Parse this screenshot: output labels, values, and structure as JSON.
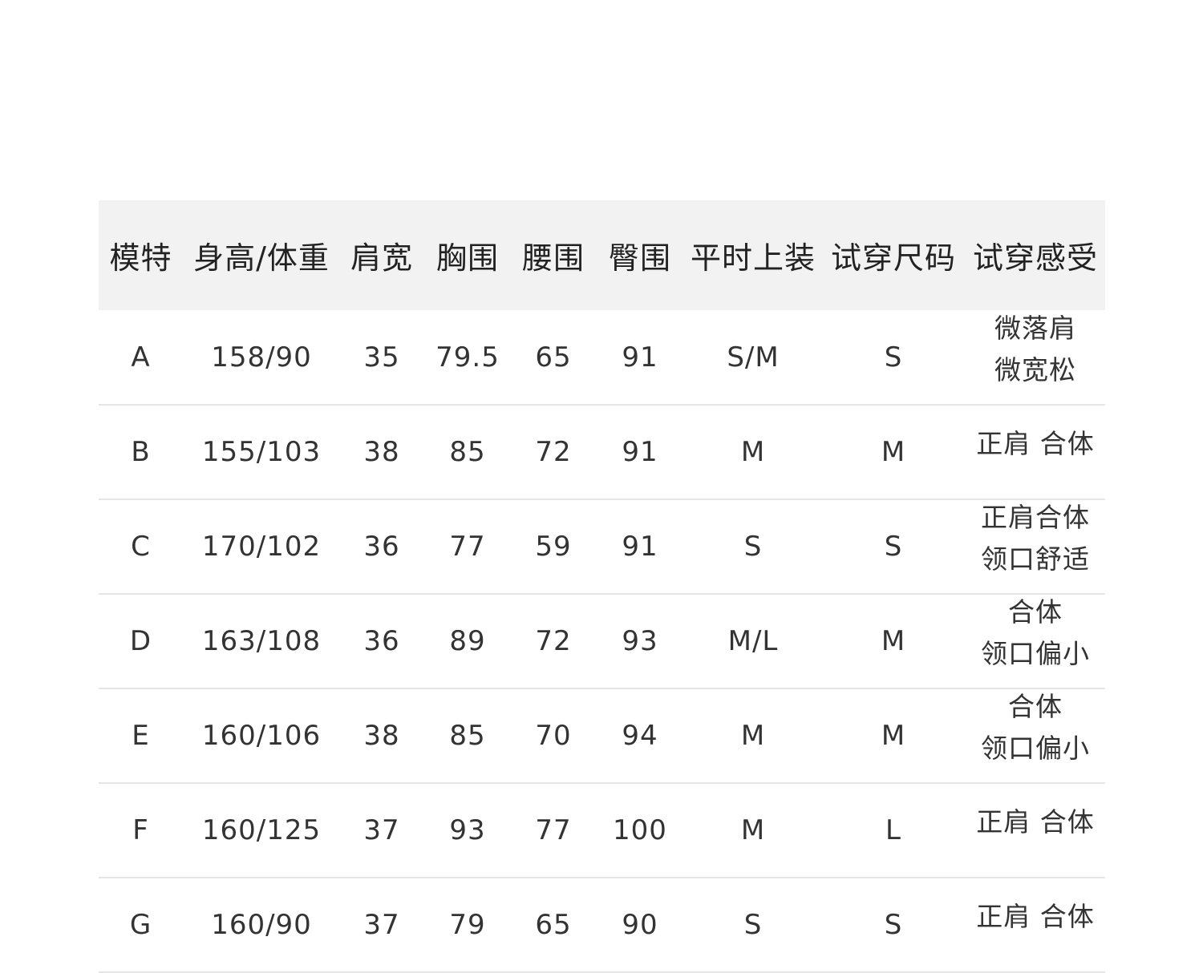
{
  "table": {
    "headers": [
      "模特",
      "身高/体重",
      "肩宽",
      "胸围",
      "腰围",
      "臀围",
      "平时上装",
      "试穿尺码",
      "试穿感受"
    ],
    "rows": [
      [
        "A",
        "158/90",
        "35",
        "79.5",
        "65",
        "91",
        "S/M",
        "S",
        "微落肩\n微宽松"
      ],
      [
        "B",
        "155/103",
        "38",
        "85",
        "72",
        "91",
        "M",
        "M",
        "正肩 合体"
      ],
      [
        "C",
        "170/102",
        "36",
        "77",
        "59",
        "91",
        "S",
        "S",
        "正肩合体\n领口舒适"
      ],
      [
        "D",
        "163/108",
        "36",
        "89",
        "72",
        "93",
        "M/L",
        "M",
        "合体\n领口偏小"
      ],
      [
        "E",
        "160/106",
        "38",
        "85",
        "70",
        "94",
        "M",
        "M",
        "合体\n领口偏小"
      ],
      [
        "F",
        "160/125",
        "37",
        "93",
        "77",
        "100",
        "M",
        "L",
        "正肩 合体"
      ],
      [
        "G",
        "160/90",
        "37",
        "79",
        "65",
        "90",
        "S",
        "S",
        "正肩 合体"
      ]
    ]
  }
}
